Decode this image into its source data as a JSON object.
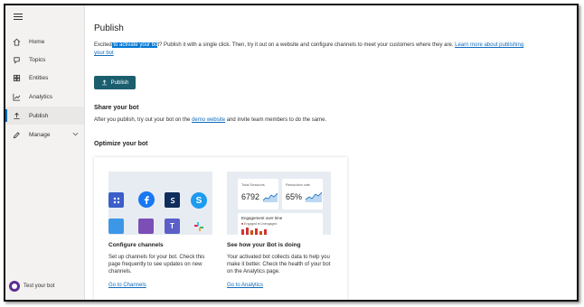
{
  "sidebar": {
    "items": [
      {
        "label": "Home",
        "icon": "home-icon"
      },
      {
        "label": "Topics",
        "icon": "topics-icon"
      },
      {
        "label": "Entities",
        "icon": "entities-icon"
      },
      {
        "label": "Analytics",
        "icon": "analytics-icon"
      },
      {
        "label": "Publish",
        "icon": "publish-icon",
        "active": true
      },
      {
        "label": "Manage",
        "icon": "manage-icon"
      }
    ],
    "test_bot_label": "Test your bot"
  },
  "main": {
    "title": "Publish",
    "intro_before": "Excited",
    "intro_highlight": " to activate your bo",
    "intro_after": "t? Publish it with a single click. Then, try it out on a website and configure channels to meet your customers where they are. ",
    "intro_link": "Learn more about publishing your bot",
    "publish_button": "Publish",
    "share_heading": "Share your bot",
    "share_before": "After you publish, try out your bot on the ",
    "share_link": "demo website",
    "share_after": " and invite team members to do the same.",
    "optimize_heading": "Optimize your bot",
    "cards": [
      {
        "title": "Configure channels",
        "description": "Set up channels for your bot. Check this page frequently to see updates on new channels.",
        "link": "Go to Channels"
      },
      {
        "title": "See how your Bot is doing",
        "description": "Your activated bot collects data to help you make it better. Check the health of your bot on the Analytics page.",
        "link": "Go to Analytics",
        "stats": {
          "sessions_label": "Total Sessions",
          "sessions_value": "6792",
          "resolution_label": "Resolution rate",
          "resolution_value": "65%",
          "engagement_label": "Engagement over time",
          "legend_engaged": "Engaged",
          "legend_unengaged": "Unengaged"
        }
      }
    ]
  },
  "colors": {
    "accent": "#0f6cbd",
    "publish_button": "#1b5f6f",
    "avatar": "#5c2e91"
  }
}
